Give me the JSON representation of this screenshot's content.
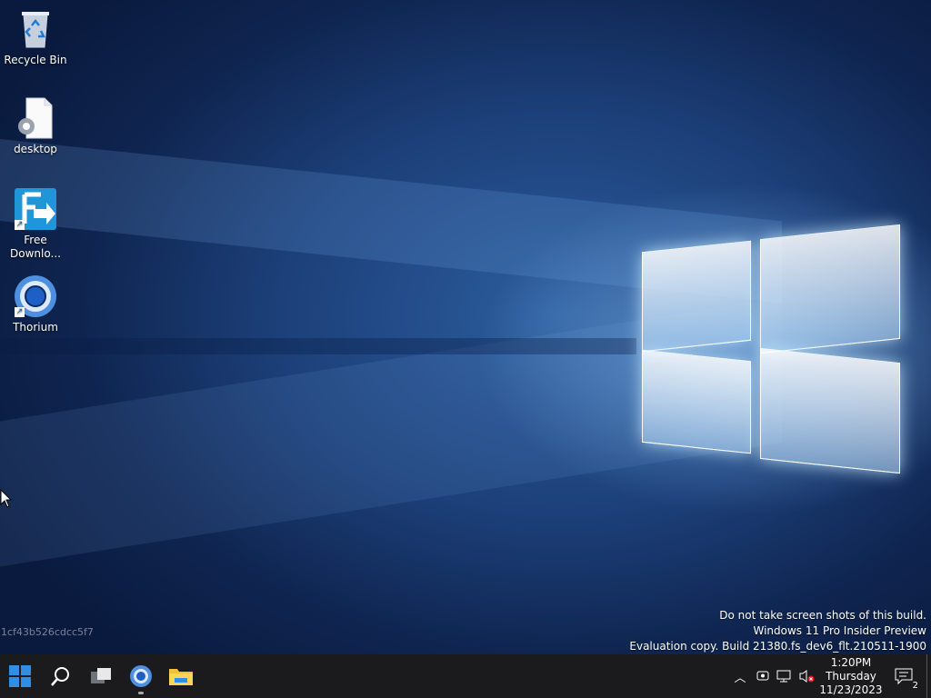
{
  "desktop_icons": [
    {
      "label": "Recycle Bin",
      "icon": "recycle-bin-icon"
    },
    {
      "label": "desktop",
      "icon": "settings-file-icon"
    },
    {
      "label": "Free Downlo...",
      "icon": "free-download-manager-icon"
    },
    {
      "label": "Thorium",
      "icon": "thorium-browser-icon"
    }
  ],
  "watermark": {
    "line1": "Do not take screen shots of this build.",
    "line2": "Windows 11 Pro Insider Preview",
    "line3": "Evaluation copy. Build 21380.fs_dev6_flt.210511-1900"
  },
  "hash_text": "1cf43b526cdcc5f7",
  "taskbar": {
    "apps": [
      "start-icon",
      "search-icon",
      "task-view-icon",
      "thorium-browser-icon",
      "file-explorer-icon"
    ],
    "tray": [
      "chevron-up-icon",
      "meet-now-icon",
      "network-icon",
      "volume-muted-icon"
    ],
    "clock": {
      "time": "1:20PM",
      "day": "Thursday",
      "date": "11/23/2023"
    },
    "notifications_count": "2"
  },
  "colors": {
    "taskbar": "#1b1b1d",
    "accent": "#2f8fe6"
  }
}
